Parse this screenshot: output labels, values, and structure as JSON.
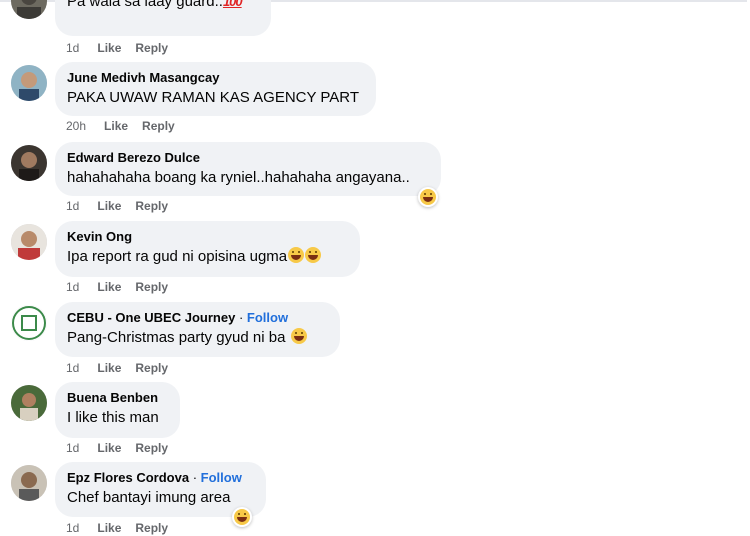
{
  "comments": [
    {
      "author": "",
      "text": "Pa wala sa laay guard..",
      "emoji": "100",
      "time": "1d",
      "like": "Like",
      "reply": "Reply"
    },
    {
      "author": "June Medivh Masangcay",
      "text": "PAKA UWAW RAMAN KAS AGENCY PART",
      "time": "20h",
      "like": "Like",
      "reply": "Reply"
    },
    {
      "author": "Edward Berezo Dulce",
      "text": "hahahahaha boang ka ryniel..hahahaha angayana..",
      "time": "1d",
      "like": "Like",
      "reply": "Reply"
    },
    {
      "author": "Kevin Ong",
      "text": "Ipa report ra gud ni opisina ugma",
      "time": "1d",
      "like": "Like",
      "reply": "Reply"
    },
    {
      "author": "CEBU - One UBEC Journey",
      "follow": "Follow",
      "separator": "·",
      "text": "Pang-Christmas party gyud ni ba",
      "time": "1d",
      "like": "Like",
      "reply": "Reply"
    },
    {
      "author": "Buena Benben",
      "text": "I like this man",
      "time": "1d",
      "like": "Like",
      "reply": "Reply"
    },
    {
      "author": "Epz Flores Cordova",
      "follow": "Follow",
      "separator": "·",
      "text": "Chef bantayi imung area",
      "time": "1d",
      "like": "Like",
      "reply": "Reply"
    }
  ],
  "colors": {
    "bubble": "#f0f2f5",
    "follow": "#216fdb",
    "meta": "#65676b"
  },
  "icons": [
    "hundred-points-icon",
    "grinning-emoji-icon",
    "laughing-emoji-icon",
    "reaction-icon"
  ]
}
